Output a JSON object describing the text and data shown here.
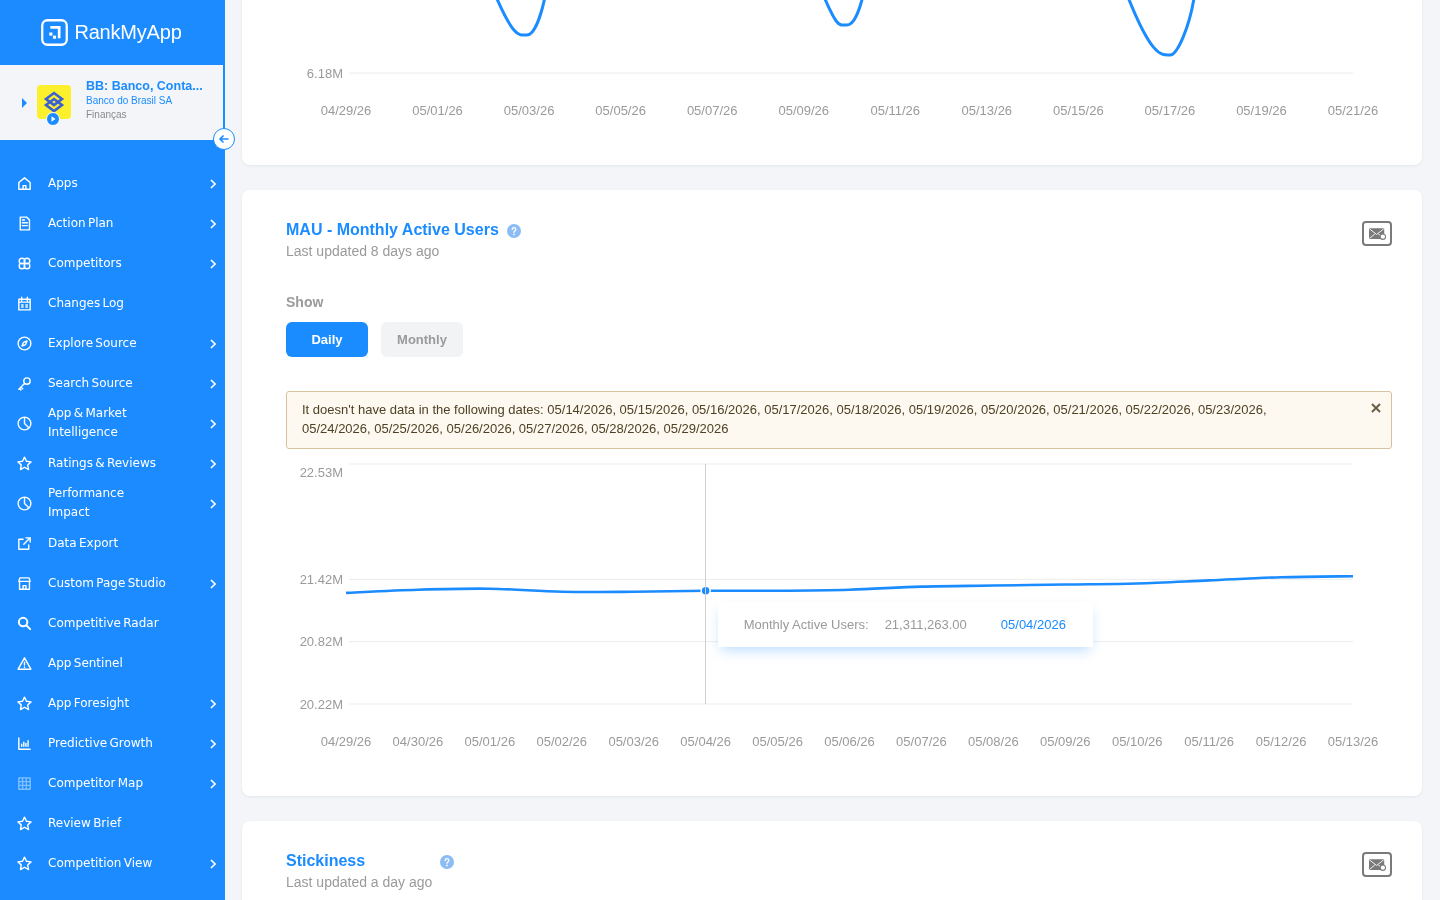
{
  "sidebar": {
    "brand": "RankMyApp",
    "app": {
      "name": "BB: Banco, Conta...",
      "publisher": "Banco do Brasil SA",
      "category": "Finanças"
    },
    "items": [
      {
        "label": "Apps",
        "has_submenu": true
      },
      {
        "label": "Action Plan",
        "has_submenu": true
      },
      {
        "label": "Competitors",
        "has_submenu": true
      },
      {
        "label": "Changes Log",
        "has_submenu": false
      },
      {
        "label": "Explore Source",
        "has_submenu": true
      },
      {
        "label": "Search Source",
        "has_submenu": true
      },
      {
        "label": "App & Market Intelligence",
        "has_submenu": true
      },
      {
        "label": "Ratings & Reviews",
        "has_submenu": true
      },
      {
        "label": "Performance Impact",
        "has_submenu": true
      },
      {
        "label": "Data Export",
        "has_submenu": false
      },
      {
        "label": "Custom Page Studio",
        "has_submenu": true
      },
      {
        "label": "Competitive Radar",
        "has_submenu": false
      },
      {
        "label": "App Sentinel",
        "has_submenu": false
      },
      {
        "label": "App Foresight",
        "has_submenu": true
      },
      {
        "label": "Predictive Growth",
        "has_submenu": true
      },
      {
        "label": "Competitor Map",
        "has_submenu": true
      },
      {
        "label": "Review Brief",
        "has_submenu": false
      },
      {
        "label": "Competition View",
        "has_submenu": true
      }
    ]
  },
  "overview_chart": {
    "y_tick": "6.18M",
    "x_labels": [
      "04/29/26",
      "05/01/26",
      "05/03/26",
      "05/05/26",
      "05/07/26",
      "05/09/26",
      "05/11/26",
      "05/13/26",
      "05/15/26",
      "05/17/26",
      "05/19/26",
      "05/21/26"
    ]
  },
  "mau_card": {
    "title": "MAU - Monthly Active Users",
    "updated": "Last updated 8 days ago",
    "show_label": "Show",
    "toggle": [
      {
        "label": "Daily",
        "selected": true
      },
      {
        "label": "Monthly",
        "selected": false
      }
    ],
    "alert": {
      "text": "It doesn't have data in the following dates: 05/14/2026, 05/15/2026, 05/16/2026, 05/17/2026, 05/18/2026, 05/19/2026, 05/20/2026, 05/21/2026, 05/22/2026, 05/23/2026, 05/24/2026, 05/25/2026, 05/26/2026, 05/27/2026, 05/28/2026, 05/29/2026"
    },
    "chart_data": {
      "type": "line",
      "categories": [
        "04/29/26",
        "04/30/26",
        "05/01/26",
        "05/02/26",
        "05/03/26",
        "05/04/26",
        "05/05/26",
        "05/06/26",
        "05/07/26",
        "05/08/26",
        "05/09/26",
        "05/10/26",
        "05/11/26",
        "05/12/26",
        "05/13/26"
      ],
      "series": [
        {
          "color": "#1a8cff",
          "values": [
            21.29,
            21.32,
            21.33,
            21.3,
            21.3,
            21.31,
            21.31,
            21.32,
            21.35,
            21.36,
            21.37,
            21.38,
            21.41,
            21.44,
            21.45
          ]
        }
      ],
      "ylim": [
        20.22,
        22.53
      ],
      "yticks": [
        {
          "value": 22.53,
          "label": "22.53M"
        },
        {
          "value": 21.42,
          "label": "21.42M"
        },
        {
          "value": 20.82,
          "label": "20.82M"
        },
        {
          "value": 20.22,
          "label": "20.22M"
        }
      ],
      "annotations": [
        {
          "x": "05/04/26"
        }
      ]
    },
    "tooltip": {
      "label": "Monthly Active Users:",
      "value": "21,311,263.00",
      "date": "05/04/2026"
    }
  },
  "stickiness_card": {
    "title": "Stickiness",
    "updated": "Last updated a day ago"
  }
}
